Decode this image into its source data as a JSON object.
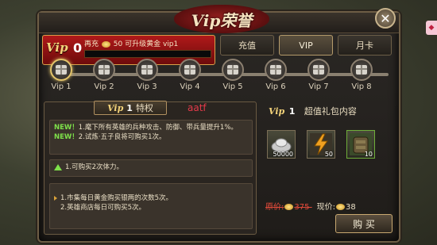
{
  "window": {
    "title": "Vip荣誉",
    "close_label": "✕"
  },
  "vip_header": {
    "badge": "Vip",
    "level": "0",
    "info_prefix": "再充",
    "info_amount": "50",
    "info_suffix": "可升级黄金 vip1",
    "progress": 0
  },
  "tabs": [
    {
      "label": "充值",
      "active": false
    },
    {
      "label": "VIP",
      "active": true
    },
    {
      "label": "月卡",
      "active": false
    }
  ],
  "levels": [
    {
      "label": "Vip 1",
      "active": true
    },
    {
      "label": "Vip 2",
      "active": false
    },
    {
      "label": "Vip 3",
      "active": false
    },
    {
      "label": "Vip 4",
      "active": false
    },
    {
      "label": "Vip 5",
      "active": false
    },
    {
      "label": "Vip 6",
      "active": false
    },
    {
      "label": "Vip 7",
      "active": false
    },
    {
      "label": "Vip 8",
      "active": false
    }
  ],
  "privilege": {
    "vip_tag": "Vip",
    "vip_num": "1",
    "title": "特权",
    "watermark": "aatf",
    "new_label": "NEW！",
    "new_items": [
      "1.麾下所有英雄的兵种攻击、防御、带兵量提升1%。",
      "2.试炼·五子良将可购买1次。"
    ],
    "up_item": "1.可购买2次体力。",
    "list_items": [
      "1.市集每日黄金购买银两的次数5次。",
      "2.英雄商店每日可购买5次。"
    ]
  },
  "gift_pack": {
    "vip_tag": "Vip",
    "vip_num": "1",
    "title": "超值礼包内容",
    "items": [
      {
        "icon": "silver-ingot-icon",
        "count": "50000"
      },
      {
        "icon": "lightning-scroll-icon",
        "count": "50"
      },
      {
        "icon": "armor-pack-icon",
        "count": "10"
      }
    ],
    "original_label": "原价:",
    "original_price": "375",
    "current_label": "现价:",
    "current_price": "38",
    "buy_label": "购 买"
  },
  "colors": {
    "accent_gold": "#f4d37a",
    "vip_red": "#b0191a",
    "new_green": "#7ee04a",
    "strike_red": "#e14a3a"
  }
}
